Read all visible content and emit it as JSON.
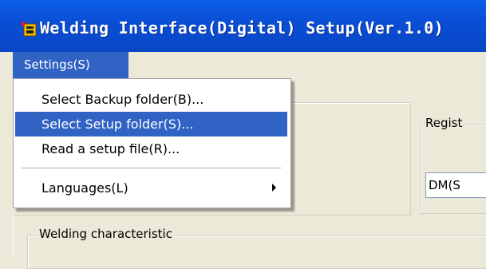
{
  "window": {
    "title": "Welding Interface(Digital) Setup(Ver.1.0)",
    "titlebar_color": "#0a52dc"
  },
  "menubar": {
    "settings_label": "Settings(S)"
  },
  "settings_menu": {
    "items": [
      {
        "label": "Select Backup folder(B)...",
        "highlighted": false
      },
      {
        "label": "Select Setup folder(S)...",
        "highlighted": true
      },
      {
        "label": "Read a setup file(R)...",
        "highlighted": false
      },
      {
        "label": "Languages(L)",
        "highlighted": false,
        "submenu": true
      }
    ],
    "highlight_color": "#3163c5"
  },
  "form": {
    "register_group_label": "Regist",
    "register_field_value": "DM(S",
    "welding_group_label": "Welding characteristic"
  }
}
